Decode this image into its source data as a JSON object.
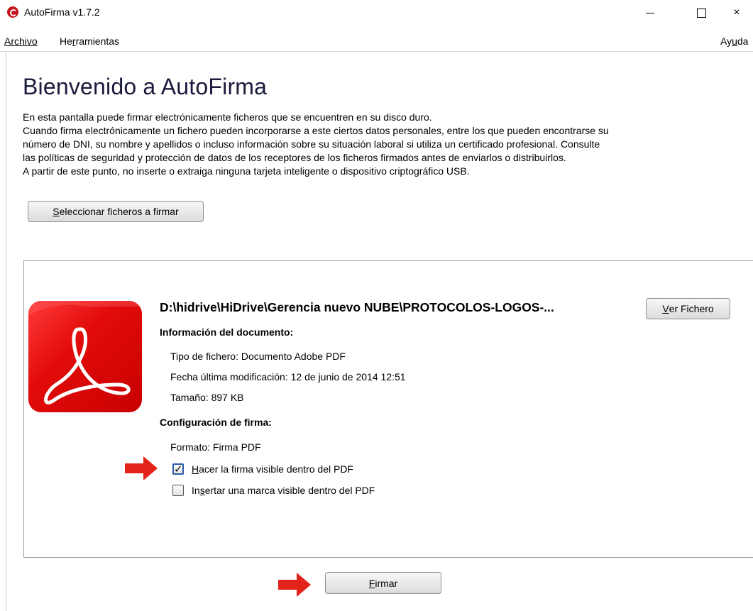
{
  "window": {
    "title": "AutoFirma v1.7.2",
    "controls": {
      "minimize": "minimize",
      "maximize": "maximize",
      "close": "×"
    }
  },
  "menu": {
    "archivo": "Archivo",
    "herramientas_pre": "He",
    "herramientas_acc": "r",
    "herramientas_post": "ramientas",
    "ayuda_pre": "Ay",
    "ayuda_acc": "u",
    "ayuda_post": "da"
  },
  "welcome": {
    "title": "Bienvenido a AutoFirma",
    "lines": [
      "En esta pantalla puede firmar electrónicamente ficheros que se encuentren en su disco duro.",
      "Cuando firma electrónicamente un fichero pueden incorporarse a este ciertos datos personales, entre los que pueden encontrarse su",
      "número de DNI, su nombre y apellidos o incluso información sobre su situación laboral si utiliza un certificado profesional. Consulte",
      "las políticas de seguridad y protección de datos de los receptores de los ficheros firmados antes de enviarlos o distribuirlos.",
      "A partir de este punto, no inserte o extraiga ninguna tarjeta inteligente o dispositivo criptográfico USB."
    ]
  },
  "select_button": {
    "acc": "S",
    "rest": "eleccionar ficheros a firmar"
  },
  "file": {
    "path": "D:\\hidrive\\HiDrive\\Gerencia nuevo NUBE\\PROTOCOLOS-LOGOS-...",
    "view_button": {
      "acc": "V",
      "rest": "er Fichero"
    },
    "doc_info_heading": "Información del documento:",
    "type": "Tipo de fichero: Documento Adobe PDF",
    "modified": "Fecha última modificación: 12 de junio de 2014 12:51",
    "size": "Tamaño: 897 KB",
    "sign_config_heading": "Configuración de firma:",
    "format": "Formato: Firma PDF",
    "option_visible_signature": {
      "acc": "H",
      "rest": "acer la firma visible dentro del PDF",
      "checked": true
    },
    "option_visible_mark": {
      "pre": "In",
      "acc": "s",
      "rest": "ertar una marca visible dentro del PDF",
      "checked": false
    }
  },
  "sign_button": {
    "acc": "F",
    "rest": "irmar"
  },
  "colors": {
    "accent_red": "#e2231a",
    "title_text": "#1a1a3c"
  }
}
